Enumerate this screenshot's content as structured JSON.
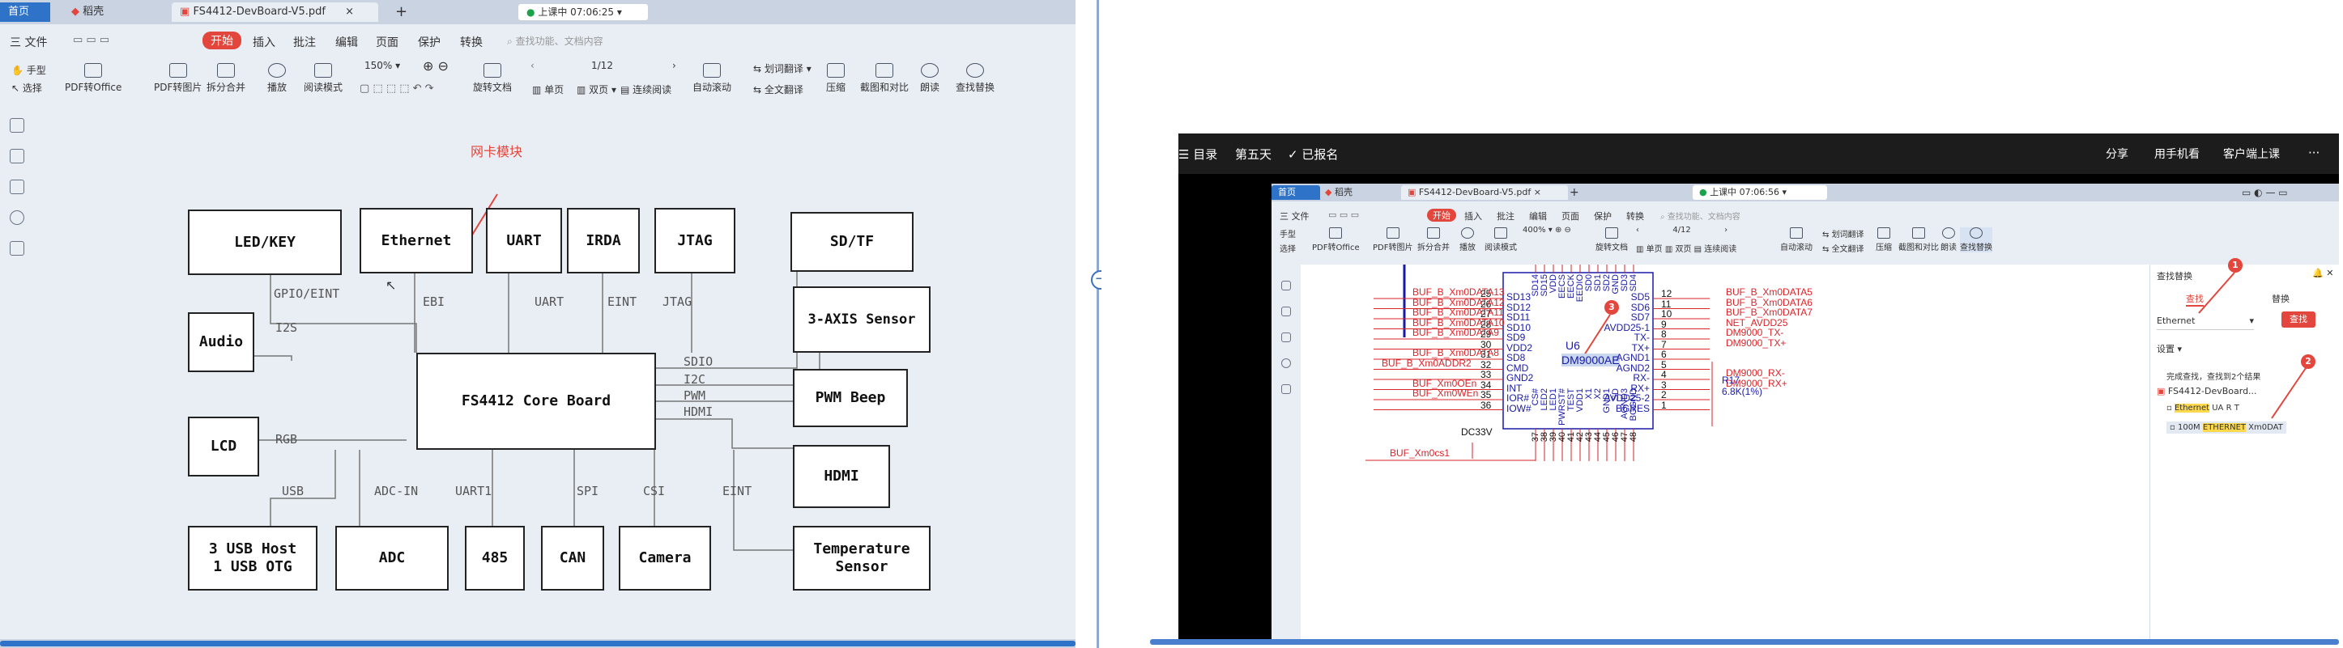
{
  "left": {
    "tabs": [
      "首页",
      "稻壳",
      "FS4412-DevBoard-V5.pdf"
    ],
    "live_status": "上课中 07:06:25",
    "menu": [
      "三 文件",
      "开始",
      "插入",
      "批注",
      "编辑",
      "页面",
      "保护",
      "转换"
    ],
    "search_placeholder": "查找功能、文档内容",
    "toolbar": {
      "hand": "手型",
      "select": "选择",
      "pdf_to_office": "PDF转Office",
      "pdf_to_image": "PDF转图片",
      "split_merge": "拆分合并",
      "play": "播放",
      "read_mode": "阅读模式",
      "zoom": "150%",
      "page": "1/12",
      "rotate": "旋转文档",
      "single_page": "单页",
      "double_page": "双页",
      "continuous": "连续阅读",
      "auto_scroll": "自动滚动",
      "translate": "划词翻译",
      "full_translate": "全文翻译",
      "compress": "压缩",
      "screenshot": "截图和对比",
      "read_aloud": "朗读",
      "find_replace": "查找替换"
    },
    "annotation": "网卡模块",
    "diagram": {
      "blocks": {
        "led_key": "LED/KEY",
        "ethernet": "Ethernet",
        "uart": "UART",
        "irda": "IRDA",
        "jtag": "JTAG",
        "sdtf": "SD/TF",
        "audio": "Audio",
        "sensor3": "3-AXIS  Sensor",
        "core": "FS4412  Core  Board",
        "pwm": "PWM  Beep",
        "lcd": "LCD",
        "hdmi": "HDMI",
        "usb_l1": "3  USB  Host",
        "usb_l2": "1  USB  OTG",
        "adc": "ADC",
        "r485": "485",
        "can": "CAN",
        "camera": "Camera",
        "temp_l1": "Temperature",
        "temp_l2": "Sensor"
      },
      "labels": {
        "gpio": "GPIO/EINT",
        "i2s": "I2S",
        "ebi": "EBI",
        "uart": "UART",
        "eint1": "EINT",
        "jtag": "JTAG",
        "sdio": "SDIO",
        "i2c": "I2C",
        "pwm": "PWM",
        "hdmi": "HDMI",
        "rgb": "RGB",
        "usb": "USB",
        "adcin": "ADC-IN",
        "uart1": "UART1",
        "spi": "SPI",
        "csi": "CSI",
        "eint2": "EINT"
      }
    }
  },
  "right": {
    "stream_header": {
      "menu": "☰ 目录",
      "lesson": "第五天",
      "signup": "✓ 已报名",
      "share": "分享",
      "phone": "用手机看",
      "client": "客户端上课",
      "more": "···"
    },
    "tabs": [
      "首页",
      "稻壳",
      "FS4412-DevBoard-V5.pdf"
    ],
    "live_status": "上课中 07:06:56",
    "menu": [
      "三 文件",
      "开始",
      "插入",
      "批注",
      "编辑",
      "页面",
      "保护",
      "转换"
    ],
    "search_placeholder": "查找功能、文档内容",
    "zoom": "400%",
    "page": "4/12",
    "toolbar": [
      "手型",
      "选择",
      "PDF转Office",
      "PDF转图片",
      "拆分合并",
      "播放",
      "阅读模式",
      "旋转文档",
      "单页",
      "双页",
      "连续阅读",
      "自动滚动",
      "划词翻译",
      "全文翻译",
      "压缩",
      "截图和对比",
      "朗读",
      "查找替换"
    ],
    "schematic": {
      "chip_ref": "U6",
      "chip_part": "DM9000AE",
      "left_pins": [
        {
          "num": "25",
          "name": "SD13",
          "net": "BUF_B_Xm0DATA13"
        },
        {
          "num": "26",
          "name": "SD12",
          "net": "BUF_B_Xm0DATA12"
        },
        {
          "num": "27",
          "name": "SD11",
          "net": "BUF_B_Xm0DATA11"
        },
        {
          "num": "28",
          "name": "SD10",
          "net": "BUF_B_Xm0DATA10"
        },
        {
          "num": "29",
          "name": "SD9",
          "net": "BUF_B_Xm0DATA9"
        },
        {
          "num": "30",
          "name": "VDD2",
          "net": ""
        },
        {
          "num": "31",
          "name": "SD8",
          "net": "BUF_B_Xm0DATA8"
        },
        {
          "num": "32",
          "name": "CMD",
          "net": "BUF_B_Xm0ADDR2"
        },
        {
          "num": "33",
          "name": "GND2",
          "net": ""
        },
        {
          "num": "34",
          "name": "INT",
          "net": "BUF_Xm0OEn"
        },
        {
          "num": "35",
          "name": "IOR#",
          "net": "BUF_Xm0WEn"
        },
        {
          "num": "36",
          "name": "IOW#",
          "net": ""
        }
      ],
      "right_pins": [
        {
          "num": "12",
          "name": "SD5",
          "net": "BUF_B_Xm0DATA5"
        },
        {
          "num": "11",
          "name": "SD6",
          "net": "BUF_B_Xm0DATA6"
        },
        {
          "num": "10",
          "name": "SD7",
          "net": "BUF_B_Xm0DATA7"
        },
        {
          "num": "9",
          "name": "AVDD25-1",
          "net": "NET_AVDD25"
        },
        {
          "num": "8",
          "name": "TX-",
          "net": "DM9000_TX-"
        },
        {
          "num": "7",
          "name": "TX+",
          "net": "DM9000_TX+"
        },
        {
          "num": "6",
          "name": "AGND1",
          "net": ""
        },
        {
          "num": "5",
          "name": "AGND2",
          "net": ""
        },
        {
          "num": "4",
          "name": "RX-",
          "net": "DM9000_RX-"
        },
        {
          "num": "3",
          "name": "RX+",
          "net": "DM9000_RX+"
        },
        {
          "num": "2",
          "name": "AVDD25-2",
          "net": ""
        },
        {
          "num": "1",
          "name": "BGRES",
          "net": ""
        }
      ],
      "top_pins": [
        "SD14",
        "SD15",
        "VDD",
        "EECS",
        "EECK",
        "EEDIO",
        "SD0",
        "SD1",
        "SD2",
        "GND",
        "SD3",
        "SD4"
      ],
      "bottom_pins": [
        "CS#",
        "LED2",
        "LED1",
        "PWRST#",
        "TEST",
        "VDD1",
        "X1",
        "X2",
        "GND1",
        "SD",
        "AGND3",
        "BGGND"
      ],
      "bottom_nums": [
        "37",
        "38",
        "39",
        "40",
        "41",
        "42",
        "43",
        "44",
        "45",
        "46",
        "47",
        "48"
      ],
      "dc": "DC33V",
      "cs_net": "BUF_Xm0cs1",
      "resistor": "R17",
      "resistor_val": "6.8K(1%)"
    },
    "search_panel": {
      "title": "查找替换",
      "tab_find": "查找",
      "tab_replace": "替换",
      "input_value": "Ethernet",
      "find_button": "查找",
      "settings": "设置",
      "result_summary": "完成查找，查找到2个结果",
      "doc_name": "FS4412-DevBoard...",
      "result1_hl": "Ethernet",
      "result1_rest": " UA R T",
      "result2_pre": "100M ",
      "result2_hl": "ETHERNET",
      "result2_rest": " Xm0DAT",
      "markers": [
        "1",
        "2",
        "3"
      ]
    }
  }
}
